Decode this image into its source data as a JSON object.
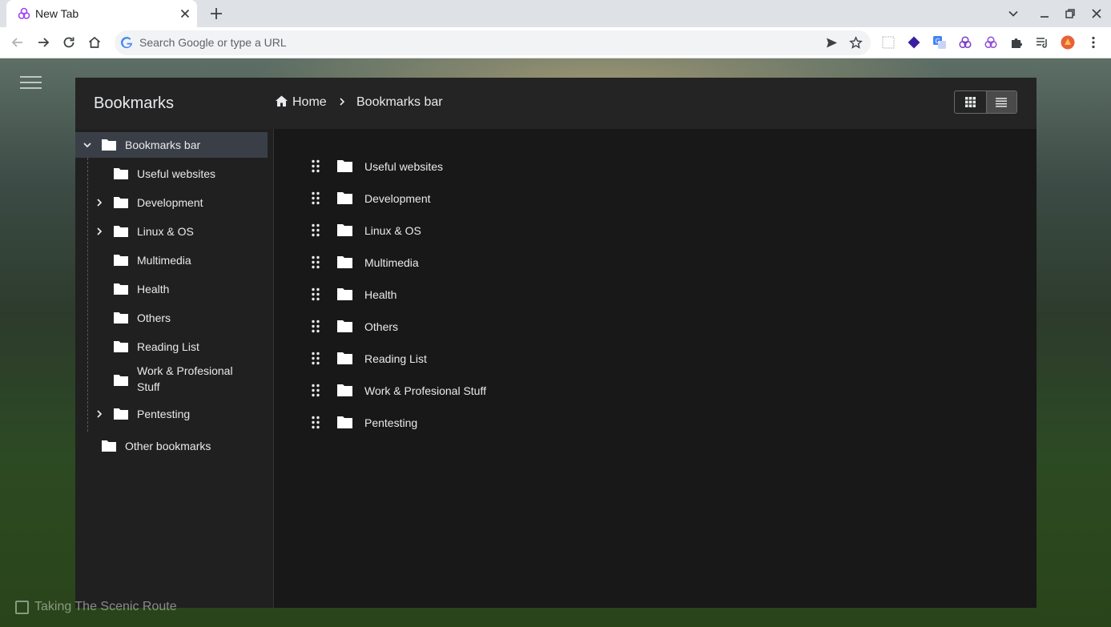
{
  "browser": {
    "tab_title": "New Tab",
    "omnibox_placeholder": "Search Google or type a URL"
  },
  "page": {
    "photo_credit": "Taking The Scenic Route"
  },
  "bookmarks": {
    "title": "Bookmarks",
    "breadcrumb": {
      "home": "Home",
      "current": "Bookmarks bar"
    },
    "view_mode": "list",
    "tree": {
      "root": "Bookmarks bar",
      "children": [
        {
          "label": "Useful websites",
          "expandable": false
        },
        {
          "label": "Development",
          "expandable": true
        },
        {
          "label": "Linux & OS",
          "expandable": true
        },
        {
          "label": "Multimedia",
          "expandable": false
        },
        {
          "label": "Health",
          "expandable": false
        },
        {
          "label": "Others",
          "expandable": false
        },
        {
          "label": "Reading List",
          "expandable": false
        },
        {
          "label": "Work & Profesional Stuff",
          "label_lines": [
            "Work & Profesional",
            "Stuff"
          ],
          "expandable": false
        },
        {
          "label": "Pentesting",
          "expandable": true
        }
      ],
      "other": "Other bookmarks"
    },
    "items": [
      "Useful websites",
      "Development",
      "Linux & OS",
      "Multimedia",
      "Health",
      "Others",
      "Reading List",
      "Work & Profesional Stuff",
      "Pentesting"
    ]
  },
  "colors": {
    "panel_bg": "#181818",
    "header_bg": "#242424",
    "selected_row": "#3a3f47",
    "text": "#e8eaed"
  }
}
